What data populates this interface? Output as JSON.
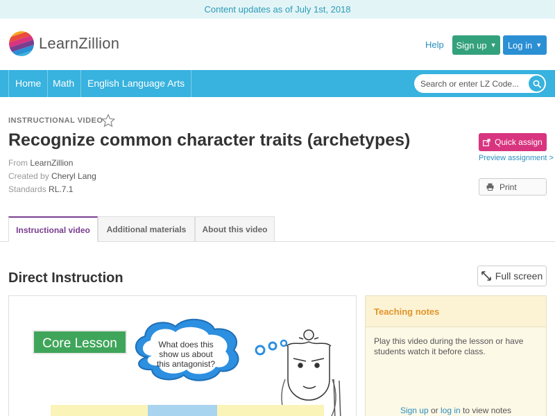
{
  "banner": {
    "text": "Content updates as of July 1st, 2018"
  },
  "header": {
    "logo_text": "LearnZillion",
    "help": "Help",
    "signup": "Sign up",
    "login": "Log in"
  },
  "nav": {
    "items": [
      "Home",
      "Math",
      "English Language Arts"
    ],
    "search_placeholder": "Search or enter LZ Code..."
  },
  "lesson": {
    "type": "INSTRUCTIONAL VIDEO",
    "title": "Recognize common character traits (archetypes)",
    "from_label": "From",
    "from_value": "LearnZillion",
    "created_label": "Created by",
    "created_value": "Cheryl Lang",
    "standards_label": "Standards",
    "standards_value": "RL.7.1"
  },
  "actions": {
    "quick_assign": "Quick assign",
    "preview": "Preview assignment >",
    "print": "Print"
  },
  "tabs": [
    "Instructional video",
    "Additional materials",
    "About this video"
  ],
  "section": {
    "title": "Direct Instruction",
    "fullscreen": "Full screen"
  },
  "video": {
    "core_lesson": "Core Lesson",
    "bubble_lines": [
      "What does this",
      "show us about",
      "this antagonist?"
    ]
  },
  "notes": {
    "title": "Teaching notes",
    "body": "Play this video during the lesson or have students watch it before class.",
    "signup": "Sign up",
    "or": " or ",
    "login": "log in",
    "suffix": " to view notes"
  },
  "colors": {
    "accent_blue": "#38b2de",
    "signup_green": "#34a17d",
    "quick_assign_pink": "#d8347f",
    "active_tab_purple": "#7a3e8f",
    "notes_orange": "#e2952b"
  }
}
